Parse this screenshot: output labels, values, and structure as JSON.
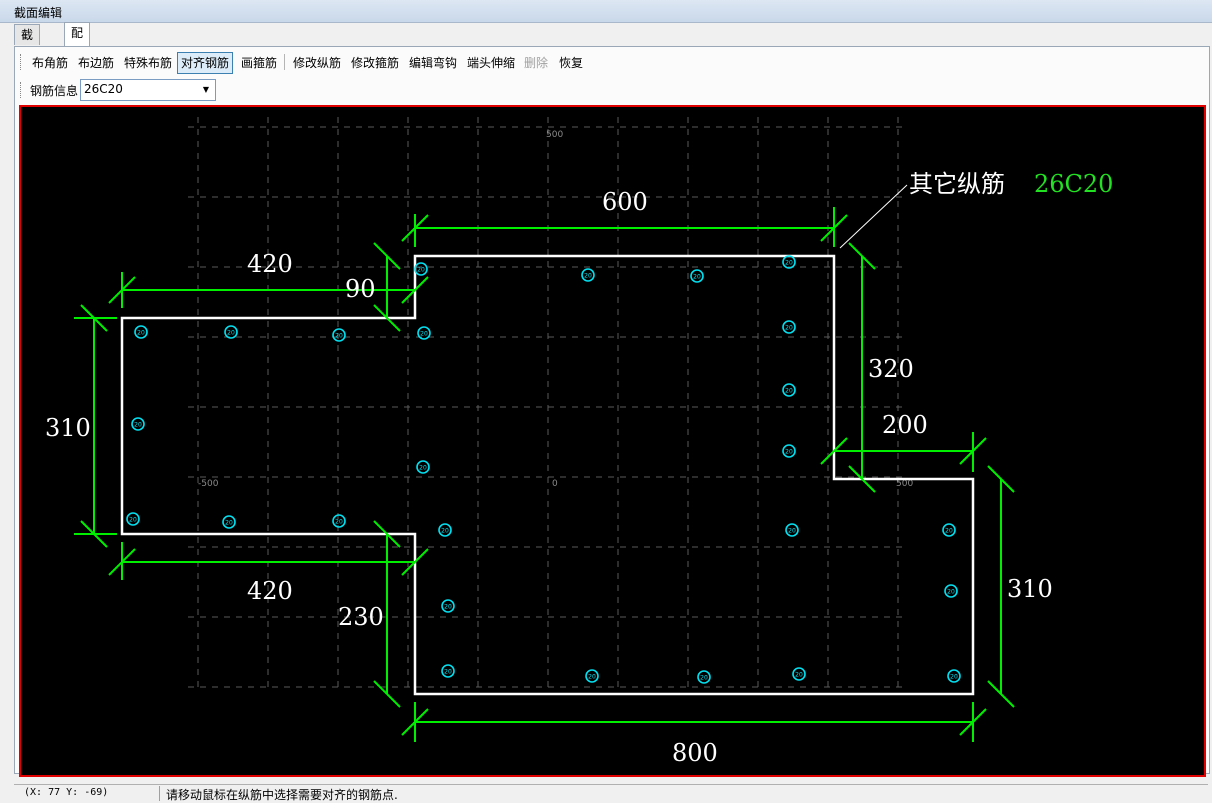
{
  "window": {
    "title": "截面编辑"
  },
  "tabs": [
    {
      "label": "截面"
    },
    {
      "label": "配筋"
    }
  ],
  "toolbar": {
    "items": [
      {
        "label": "布角筋"
      },
      {
        "label": "布边筋"
      },
      {
        "label": "特殊布筋"
      },
      {
        "label": "对齐钢筋"
      },
      {
        "label": "画箍筋"
      },
      {
        "label": "修改纵筋"
      },
      {
        "label": "修改箍筋"
      },
      {
        "label": "编辑弯钩"
      },
      {
        "label": "端头伸缩"
      },
      {
        "label": "删除"
      },
      {
        "label": "恢复"
      }
    ]
  },
  "rebar_info": {
    "label": "钢筋信息",
    "value": "26C20"
  },
  "drawing": {
    "colors": {
      "background": "#000000",
      "outline": "#ffffff",
      "dimension": "#00ee00",
      "rebar": "#00e0f0",
      "frame": "#e00000"
    },
    "axis_ticks": {
      "top": "500",
      "left": "-500",
      "center": "0",
      "right": "500"
    },
    "dims": {
      "top_600": "600",
      "left_420_top": "420",
      "step_90": "90",
      "left_310": "310",
      "right_320": "320",
      "right_200": "200",
      "left_420_bottom": "420",
      "inner_230": "230",
      "right_310": "310",
      "bottom_800": "800"
    },
    "callout": {
      "text": "其它纵筋",
      "value": "26C20"
    },
    "rebar_label": "20"
  },
  "status": {
    "coords": "(X: 77 Y: -69)",
    "message": "请移动鼠标在纵筋中选择需要对齐的钢筋点."
  }
}
